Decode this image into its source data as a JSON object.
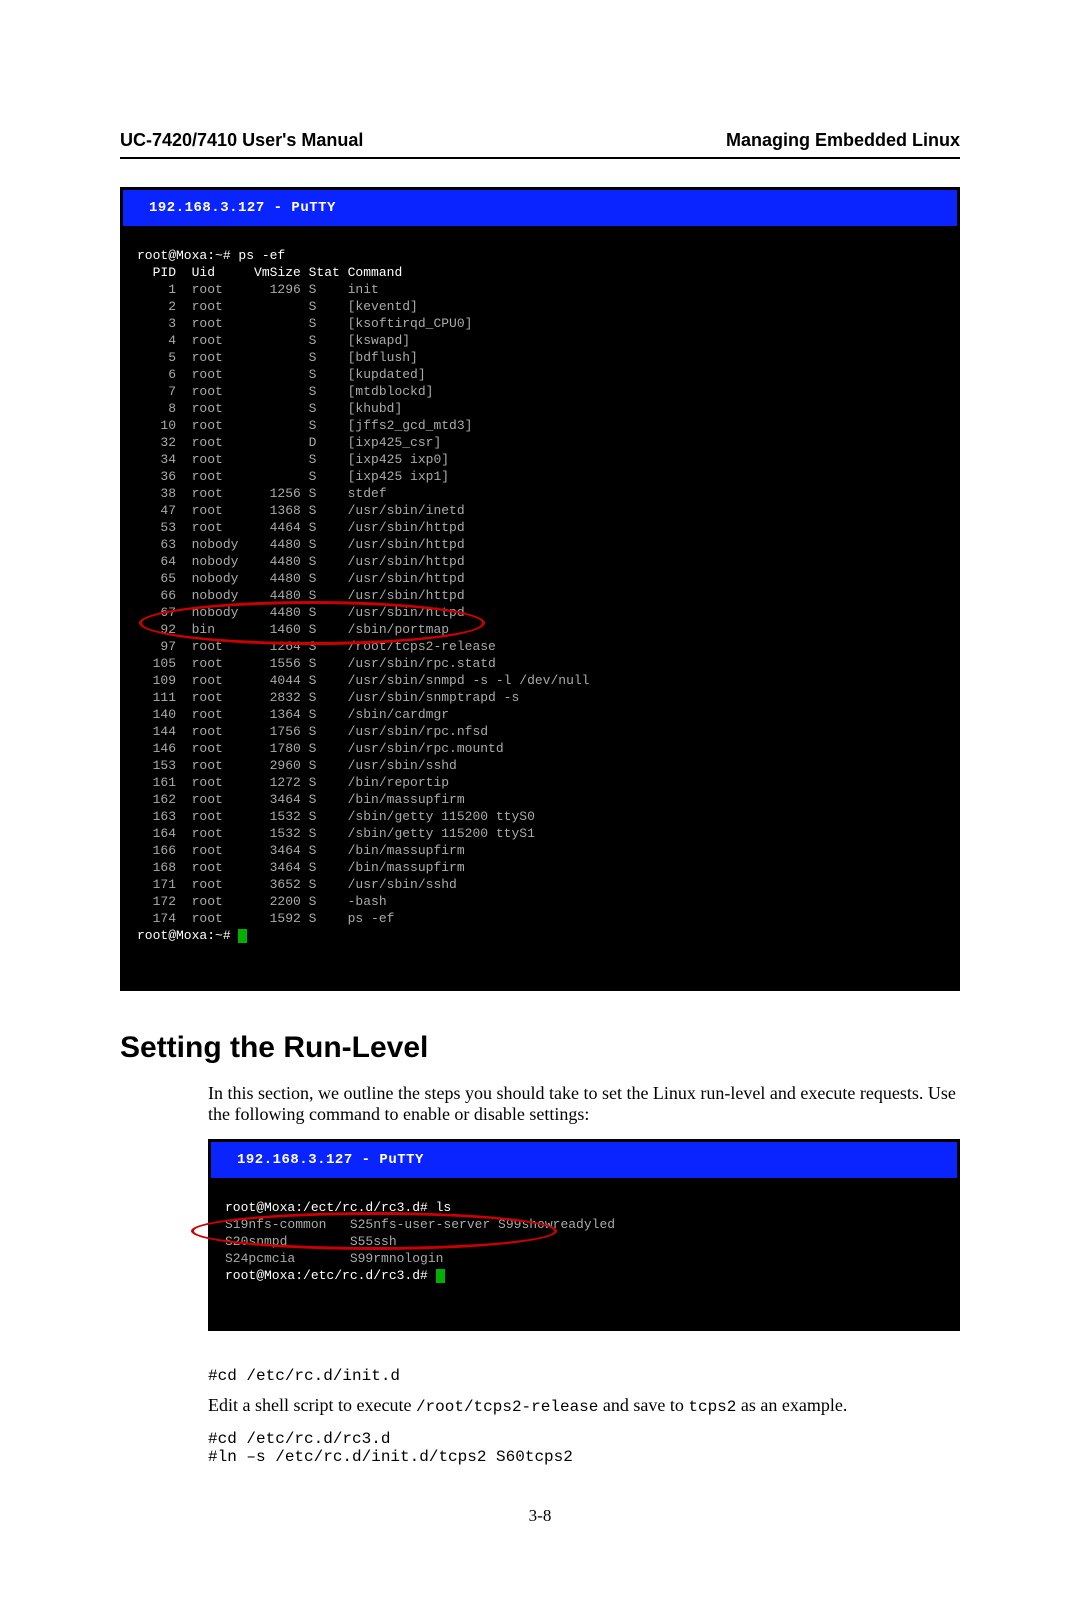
{
  "header": {
    "left": "UC-7420/7410 User's Manual",
    "right": "Managing Embedded Linux"
  },
  "terminal1": {
    "title": " 192.168.3.127 - PuTTY",
    "prompt1": "root@Moxa:~# ps -ef",
    "cols": "  PID  Uid     VmSize Stat Command",
    "rows": [
      "    1  root      1296 S    init",
      "    2  root           S    [keventd]",
      "    3  root           S    [ksoftirqd_CPU0]",
      "    4  root           S    [kswapd]",
      "    5  root           S    [bdflush]",
      "    6  root           S    [kupdated]",
      "    7  root           S    [mtdblockd]",
      "    8  root           S    [khubd]",
      "   10  root           S    [jffs2_gcd_mtd3]",
      "   32  root           D    [ixp425_csr]",
      "   34  root           S    [ixp425 ixp0]",
      "   36  root           S    [ixp425 ixp1]",
      "   38  root      1256 S    stdef",
      "   47  root      1368 S    /usr/sbin/inetd",
      "   53  root      4464 S    /usr/sbin/httpd",
      "   63  nobody    4480 S    /usr/sbin/httpd",
      "   64  nobody    4480 S    /usr/sbin/httpd",
      "   65  nobody    4480 S    /usr/sbin/httpd",
      "   66  nobody    4480 S    /usr/sbin/httpd",
      "   67  nobody    4480 S    /usr/sbin/httpd",
      "   92  bin       1460 S    /sbin/portmap",
      "   97  root      1264 S    /root/tcps2-release",
      "  105  root      1556 S    /usr/sbin/rpc.statd",
      "  109  root      4044 S    /usr/sbin/snmpd -s -l /dev/null",
      "  111  root      2832 S    /usr/sbin/snmptrapd -s",
      "  140  root      1364 S    /sbin/cardmgr",
      "  144  root      1756 S    /usr/sbin/rpc.nfsd",
      "  146  root      1780 S    /usr/sbin/rpc.mountd",
      "  153  root      2960 S    /usr/sbin/sshd",
      "  161  root      1272 S    /bin/reportip",
      "  162  root      3464 S    /bin/massupfirm",
      "  163  root      1532 S    /sbin/getty 115200 ttyS0",
      "  164  root      1532 S    /sbin/getty 115200 ttyS1",
      "  166  root      3464 S    /bin/massupfirm",
      "  168  root      3464 S    /bin/massupfirm",
      "  171  root      3652 S    /usr/sbin/sshd",
      "  172  root      2200 S    -bash",
      "  174  root      1592 S    ps -ef"
    ],
    "prompt2": "root@Moxa:~# "
  },
  "section_heading": "Setting the Run-Level",
  "intro_para": "In this section, we outline the steps you should take to set the Linux run-level and execute requests. Use the following command to enable or disable settings:",
  "terminal2": {
    "title": " 192.168.3.127 - PuTTY",
    "line1": "root@Moxa:/ect/rc.d/rc3.d# ls",
    "line2": "S19nfs-common   S25nfs-user-server S99showreadyled",
    "line3": "S20snmpd        S55ssh",
    "line4": "S24pcmcia       S99rmnologin",
    "prompt": "root@Moxa:/etc/rc.d/rc3.d# "
  },
  "cmd1": "#cd /etc/rc.d/init.d",
  "edit_text_prefix": "Edit a shell script to execute ",
  "edit_text_code1": "/root/tcps2-release",
  "edit_text_mid": " and save to ",
  "edit_text_code2": "tcps2",
  "edit_text_suffix": " as an example.",
  "cmd2": "#cd /etc/rc.d/rc3.d\n#ln –s /etc/rc.d/init.d/tcps2 S60tcps2",
  "page_number": "3-8"
}
